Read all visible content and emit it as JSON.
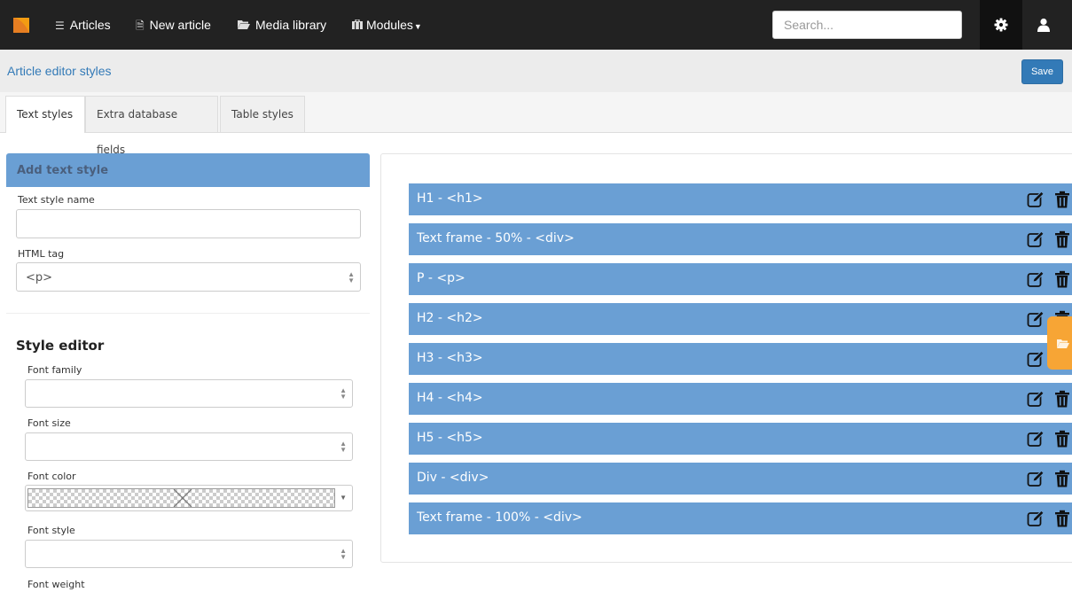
{
  "navbar": {
    "items": [
      {
        "icon": "list-icon",
        "label": "Articles"
      },
      {
        "icon": "file-icon",
        "label": "New article"
      },
      {
        "icon": "folder-open-icon",
        "label": "Media library"
      },
      {
        "icon": "briefcase-icon",
        "label": "Modules"
      }
    ],
    "search_placeholder": "Search..."
  },
  "header": {
    "title": "Article editor styles",
    "save_label": "Save"
  },
  "tabs": [
    {
      "label": "Text styles",
      "active": true
    },
    {
      "label": "Extra database fields",
      "active": false
    },
    {
      "label": "Table styles",
      "active": false
    }
  ],
  "add_style": {
    "title": "Add text style",
    "name_label": "Text style name",
    "name_value": "",
    "tag_label": "HTML tag",
    "tag_value": "<p>"
  },
  "style_editor": {
    "title": "Style editor",
    "font_family_label": "Font family",
    "font_size_label": "Font size",
    "font_color_label": "Font color",
    "font_style_label": "Font style",
    "font_weight_label": "Font weight"
  },
  "text_styles": [
    {
      "name": "H1 - <h1>"
    },
    {
      "name": "Text frame - 50% - <div>"
    },
    {
      "name": "P - <p>"
    },
    {
      "name": "H2 - <h2>"
    },
    {
      "name": "H3 - <h3>"
    },
    {
      "name": "H4 - <h4>"
    },
    {
      "name": "H5 - <h5>"
    },
    {
      "name": "Div - <div>"
    },
    {
      "name": "Text frame - 100% - <div>"
    }
  ],
  "colors": {
    "primary": "#337ab7",
    "item_bg": "#6a9fd4",
    "navbar": "#222222",
    "float_tab": "#f7a535",
    "logo": "#f39c12"
  }
}
